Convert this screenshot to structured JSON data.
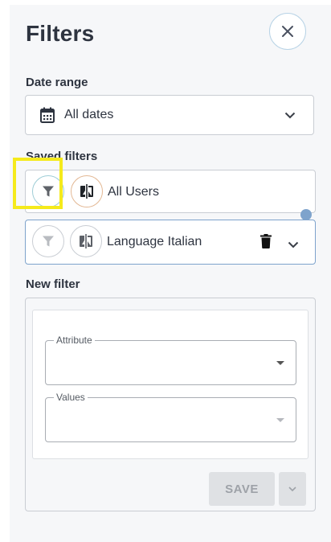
{
  "panel": {
    "title": "Filters"
  },
  "date_range": {
    "label": "Date range",
    "value": "All dates"
  },
  "saved_filters": {
    "label": "Saved filters",
    "items": [
      {
        "label": "All Users",
        "selected": true
      },
      {
        "label": "Language Italian",
        "selected": false
      }
    ]
  },
  "new_filter": {
    "label": "New filter",
    "attribute_label": "Attribute",
    "attribute_value": "",
    "values_label": "Values",
    "values_value": "",
    "save_label": "SAVE"
  },
  "colors": {
    "accent": "#7ea3cc",
    "highlight": "#f5ea1c",
    "panel_bg": "#f6f7f9"
  },
  "icons": [
    "close-icon",
    "calendar-icon",
    "chevron-down-icon",
    "filter-icon",
    "invert-filter-icon",
    "delete-icon"
  ]
}
